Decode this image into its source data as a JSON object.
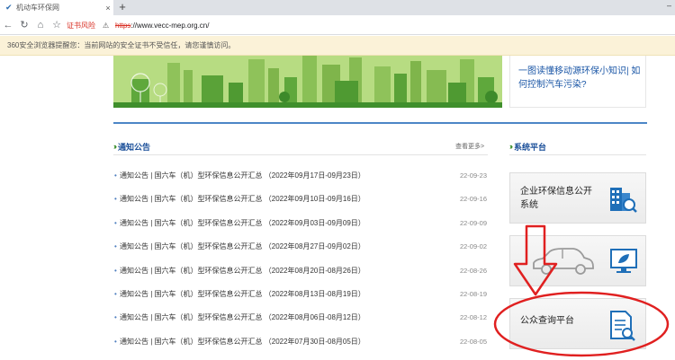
{
  "browser": {
    "tab_title": "机动车环保网",
    "tab_close": "×",
    "new_tab": "+",
    "window_controls": "–",
    "cert_warning": "证书风险",
    "url_scheme": "https",
    "url_rest": "://www.vecc-mep.org.cn/",
    "infobar_text": "360安全浏览器提醒您：当前网站的安全证书不受信任，请您谨慎访问。"
  },
  "banner": {
    "promo_text_line1": "一图读懂移动源环保小知识| 如",
    "promo_text_line2": "何控制汽车污染?"
  },
  "notices": {
    "heading": "通知公告",
    "more_label": "查看更多>",
    "items": [
      {
        "title": "通知公告 | 国六车（机）型环保信息公开汇总 （2022年09月17日-09月23日）",
        "date": "22-09-23"
      },
      {
        "title": "通知公告 | 国六车（机）型环保信息公开汇总 （2022年09月10日-09月16日）",
        "date": "22-09-16"
      },
      {
        "title": "通知公告 | 国六车（机）型环保信息公开汇总 （2022年09月03日-09月09日）",
        "date": "22-09-09"
      },
      {
        "title": "通知公告 | 国六车（机）型环保信息公开汇总 （2022年08月27日-09月02日）",
        "date": "22-09-02"
      },
      {
        "title": "通知公告 | 国六车（机）型环保信息公开汇总 （2022年08月20日-08月26日）",
        "date": "22-08-26"
      },
      {
        "title": "通知公告 | 国六车（机）型环保信息公开汇总 （2022年08月13日-08月19日）",
        "date": "22-08-19"
      },
      {
        "title": "通知公告 | 国六车（机）型环保信息公开汇总 （2022年08月06日-08月12日）",
        "date": "22-08-12"
      },
      {
        "title": "通知公告 | 国六车（机）型环保信息公开汇总 （2022年07月30日-08月05日）",
        "date": "22-08-05"
      }
    ]
  },
  "systems": {
    "heading": "系统平台",
    "cards": [
      {
        "line1": "企业环保信息公开",
        "line2": "系统",
        "icon": "building-search-icon"
      },
      {
        "line1": "",
        "line2": "",
        "icon": "car-monitor-icon"
      },
      {
        "line1": "公众查询平台",
        "line2": "",
        "icon": "document-search-icon"
      }
    ]
  },
  "annotations": {
    "arrow_color": "#e02020",
    "ellipse_color": "#e02020"
  },
  "colors": {
    "link_blue": "#1a4f99",
    "accent_green": "#3a8f2c",
    "divider_blue": "#4c86c6"
  }
}
